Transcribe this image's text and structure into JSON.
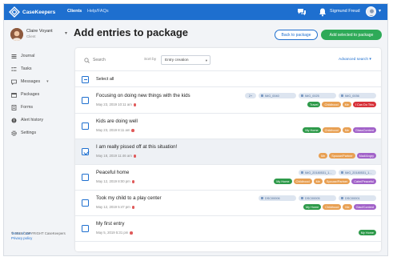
{
  "app": {
    "brand": "CaseKeepers",
    "nav": [
      "Clients",
      "Help/FAQs"
    ],
    "user_name": "Sigmund Freud"
  },
  "profile": {
    "name": "Claire Voyant",
    "role": "Client"
  },
  "sidebar": {
    "items": [
      {
        "label": "Journal",
        "icon": "journal-icon"
      },
      {
        "label": "Tasks",
        "icon": "tasks-icon"
      },
      {
        "label": "Messages",
        "icon": "messages-icon"
      },
      {
        "label": "Packages",
        "icon": "packages-icon"
      },
      {
        "label": "Forms",
        "icon": "forms-icon"
      },
      {
        "label": "Alert history",
        "icon": "alert-history-icon"
      },
      {
        "label": "Settings",
        "icon": "settings-icon"
      }
    ],
    "terms": "Terms of use",
    "privacy": "Privacy policy",
    "copyright": "© 2019 COPYRIGHT CaseKeepers"
  },
  "page": {
    "title": "Add entries to package",
    "back_button": "Back to package",
    "add_button": "Add selected to package"
  },
  "toolbar": {
    "search_placeholder": "Search",
    "sort_label": "Sort by",
    "sort_value": "Entry creation",
    "advanced_search": "Advanced search"
  },
  "select_all_label": "Select all",
  "colors": {
    "brand": "#1e6fcf",
    "add_button": "#2eaa58",
    "tag_red": "#d8333b",
    "tag_green": "#2e9a4a",
    "tag_orange": "#e8a053",
    "tag_purple": "#a263c9",
    "attachment_bg": "#dde5f0"
  },
  "entries": [
    {
      "title": "Focusing on doing new things with the kids",
      "meta": "May 23, 2019 10:11 am",
      "checked": false,
      "attachments": [
        "2+",
        "IMG_0040",
        "IMG_0025",
        "IMG_0036"
      ],
      "tags": [
        {
          "label": "Travel",
          "color": "#2e9a4a"
        },
        {
          "label": "Childhood",
          "color": "#e8a053"
        },
        {
          "label": "Me",
          "color": "#e8a053"
        },
        {
          "label": "I Can Do This",
          "color": "#d8333b"
        }
      ]
    },
    {
      "title": "Kids are doing well",
      "meta": "May 23, 2019 8:11 am",
      "checked": false,
      "attachments": [],
      "tags": [
        {
          "label": "My Home",
          "color": "#2e9a4a"
        },
        {
          "label": "Childhood",
          "color": "#e8a053"
        },
        {
          "label": "Me",
          "color": "#e8a053"
        },
        {
          "label": "GlassContent",
          "color": "#a263c9"
        }
      ]
    },
    {
      "title": "I am really pissed off at this situation!",
      "meta": "May 18, 2019 11:46 am",
      "checked": true,
      "attachments": [],
      "tags": [
        {
          "label": "Me",
          "color": "#e8a053"
        },
        {
          "label": "Spouse/Partner",
          "color": "#e8a053"
        },
        {
          "label": "Mad/Angry",
          "color": "#a263c9"
        }
      ]
    },
    {
      "title": "Peaceful home",
      "meta": "May 12, 2019 8:00 pm",
      "checked": false,
      "attachments": [
        "IMG_20180531_1...",
        "IMG_20180531_1..."
      ],
      "tags": [
        {
          "label": "My Home",
          "color": "#2e9a4a"
        },
        {
          "label": "Childhood",
          "color": "#e8a053"
        },
        {
          "label": "Me",
          "color": "#e8a053"
        },
        {
          "label": "Spouse/Partner",
          "color": "#e8a053"
        },
        {
          "label": "Calm/Peaceful",
          "color": "#a263c9"
        }
      ]
    },
    {
      "title": "Took my child to a play center",
      "meta": "May 12, 2019 5:47 pm",
      "checked": false,
      "attachments": [
        "DSC00006",
        "DSC00005",
        "DSC00001"
      ],
      "tags": [
        {
          "label": "My Home",
          "color": "#2e9a4a"
        },
        {
          "label": "Childhood",
          "color": "#e8a053"
        },
        {
          "label": "Me",
          "color": "#e8a053"
        },
        {
          "label": "Glad/Content",
          "color": "#a263c9"
        }
      ]
    },
    {
      "title": "My first entry",
      "meta": "May 5, 2019 5:31 pm",
      "checked": false,
      "attachments": [],
      "tags": [
        {
          "label": "My Home",
          "color": "#2e9a4a"
        }
      ]
    }
  ]
}
